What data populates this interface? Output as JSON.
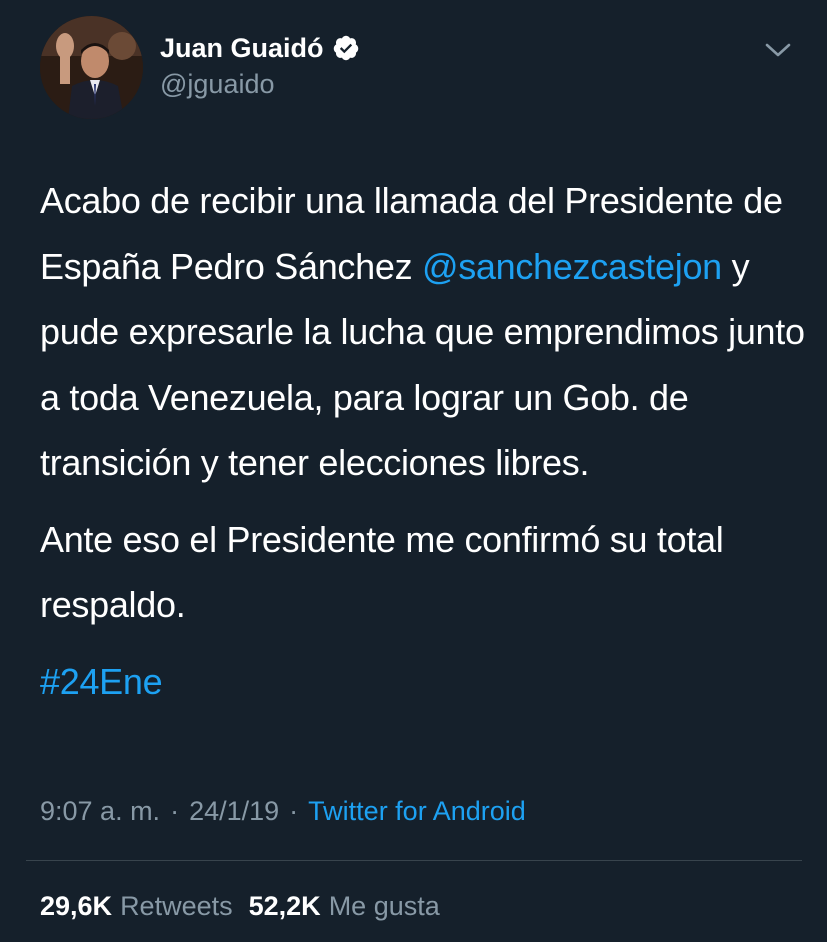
{
  "user": {
    "display_name": "Juan Guaidó",
    "handle": "@jguaido",
    "verified": true,
    "avatar_icon": "profile-photo"
  },
  "menu": {
    "icon": "chevron-down-icon"
  },
  "tweet": {
    "p1_before": "Acabo de recibir una llamada del Presidente de España Pedro Sánchez ",
    "mention": "@sanchezcastejon",
    "p1_after": " y pude expresarle la lucha que emprendimos junto a toda Venezuela, para lograr un Gob. de transición y tener elecciones libres.",
    "p2": "Ante eso el Presidente me confirmó su total respaldo.",
    "hashtag": "#24Ene"
  },
  "meta": {
    "time": "9:07 a. m.",
    "separator": "·",
    "date": "24/1/19",
    "source": "Twitter for Android"
  },
  "stats": {
    "retweets_count": "29,6K",
    "retweets_label": "Retweets",
    "likes_count": "52,2K",
    "likes_label": "Me gusta"
  },
  "colors": {
    "background": "#15202b",
    "text": "#ffffff",
    "secondary": "#8899a6",
    "accent": "#1da1f2",
    "divider": "#38444d"
  }
}
